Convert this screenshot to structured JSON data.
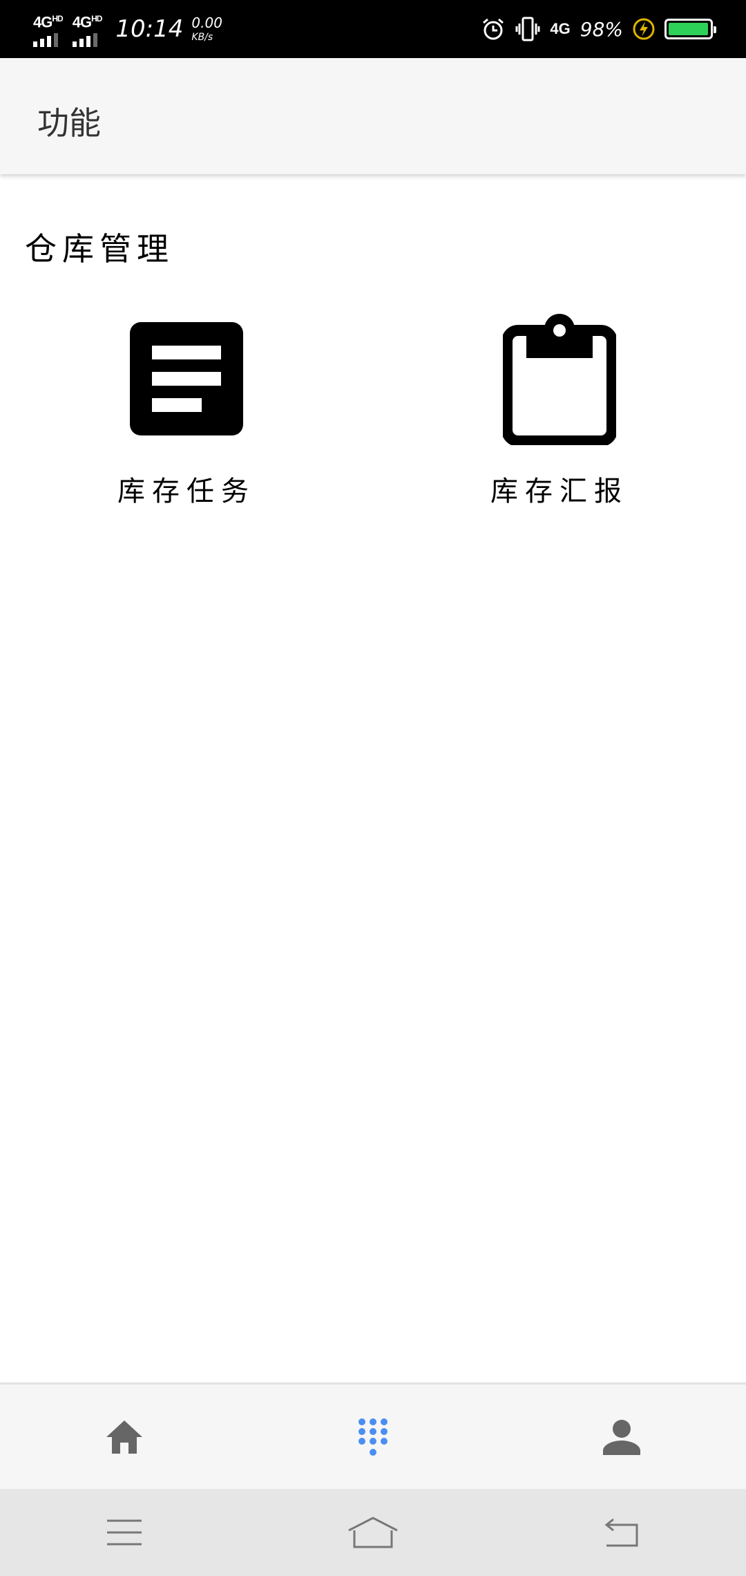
{
  "status_bar": {
    "sim1_label": "4G",
    "sim1_suffix": "HD",
    "sim2_label": "4G",
    "sim2_suffix": "HD",
    "time": "10:14",
    "net_speed_value": "0.00",
    "net_speed_unit": "KB/s",
    "network_type": "4G",
    "battery_percent": "98%",
    "battery_fill_fraction": 0.98,
    "icons": [
      "alarm-icon",
      "vibrate-icon",
      "charging-icon",
      "battery-icon"
    ]
  },
  "app_bar": {
    "title": "功能"
  },
  "section": {
    "title": "仓库管理",
    "tiles": [
      {
        "label": "库存任务",
        "icon": "document-list-icon"
      },
      {
        "label": "库存汇报",
        "icon": "clipboard-icon"
      }
    ]
  },
  "tab_bar": {
    "tabs": [
      {
        "icon": "home-icon",
        "active": false
      },
      {
        "icon": "apps-grid-icon",
        "active": true
      },
      {
        "icon": "person-icon",
        "active": false
      }
    ],
    "active_color": "#4a8ef0",
    "inactive_color": "#666666"
  },
  "system_nav": {
    "buttons": [
      "menu-icon",
      "home-outline-icon",
      "back-icon"
    ]
  }
}
